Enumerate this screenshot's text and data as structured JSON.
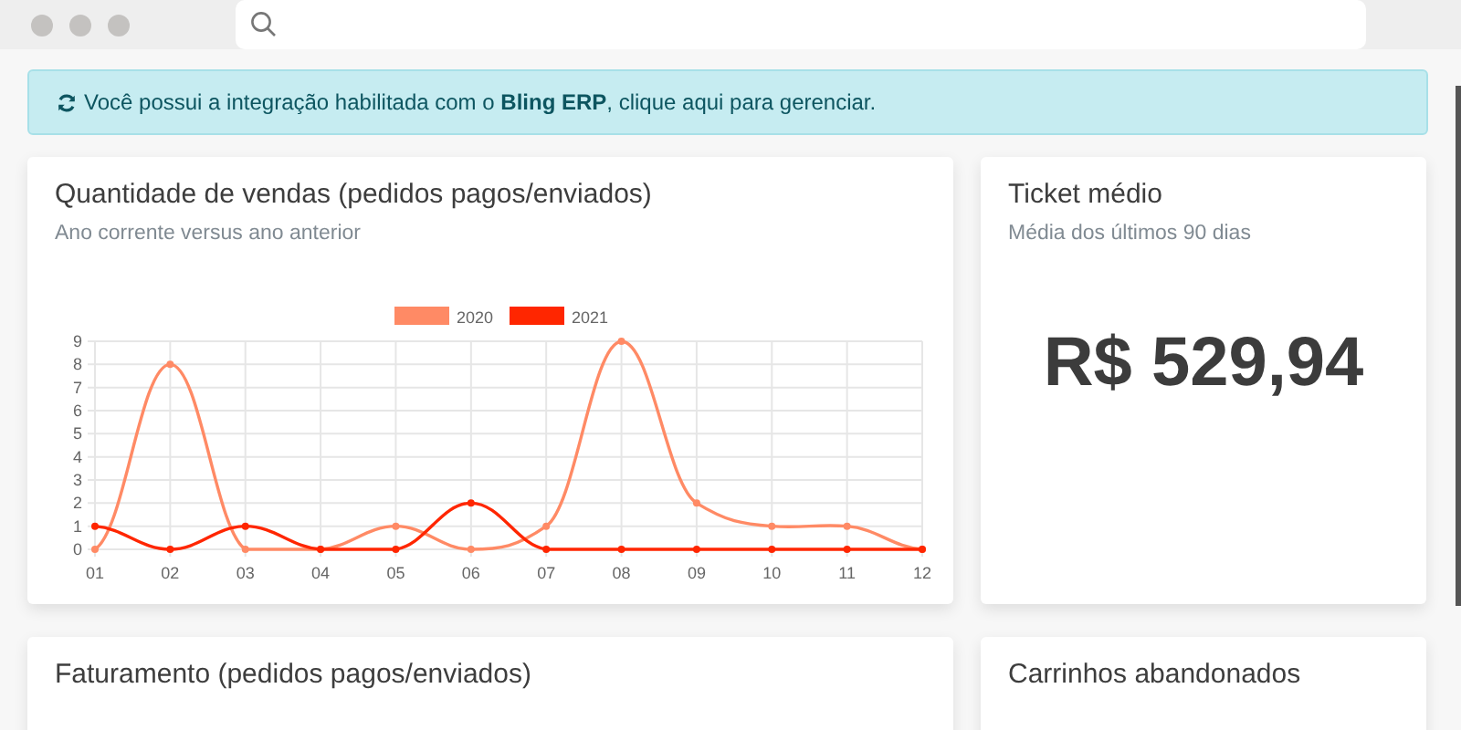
{
  "alert": {
    "text": "Você possui a integração habilitada com o **Bling ERP**, clique aqui para gerenciar."
  },
  "cards": [
    {
      "kind": "chart",
      "title": "Quantidade de vendas (pedidos pagos/enviados)",
      "subtitle": "Ano corrente versus ano anterior",
      "chart_data": {
        "type": "line",
        "categories": [
          "01",
          "02",
          "03",
          "04",
          "05",
          "06",
          "07",
          "08",
          "09",
          "10",
          "11",
          "12"
        ],
        "series": [
          {
            "name": "2020",
            "color": "#ff8a65",
            "marker": true,
            "values": [
              0,
              8,
              0,
              0,
              1,
              0,
              1,
              9,
              2,
              1,
              1,
              0
            ]
          },
          {
            "name": "2021",
            "color": "#ff2600",
            "marker": true,
            "values": [
              1,
              0,
              1,
              0,
              0,
              2,
              0,
              0,
              0,
              0,
              0,
              0
            ]
          }
        ],
        "grid": true,
        "legend": true,
        "ylim": [
          0,
          9
        ],
        "yticks": [
          0,
          1,
          2,
          3,
          4,
          5,
          6,
          7,
          8,
          9
        ]
      }
    },
    {
      "kind": "value",
      "title": "Ticket médio",
      "subtitle": "Média dos últimos 90 dias",
      "value": "R$ 529,94"
    },
    {
      "kind": "plain",
      "title": "Faturamento (pedidos pagos/enviados)"
    },
    {
      "kind": "plain",
      "title": "Carrinhos abandonados"
    }
  ]
}
